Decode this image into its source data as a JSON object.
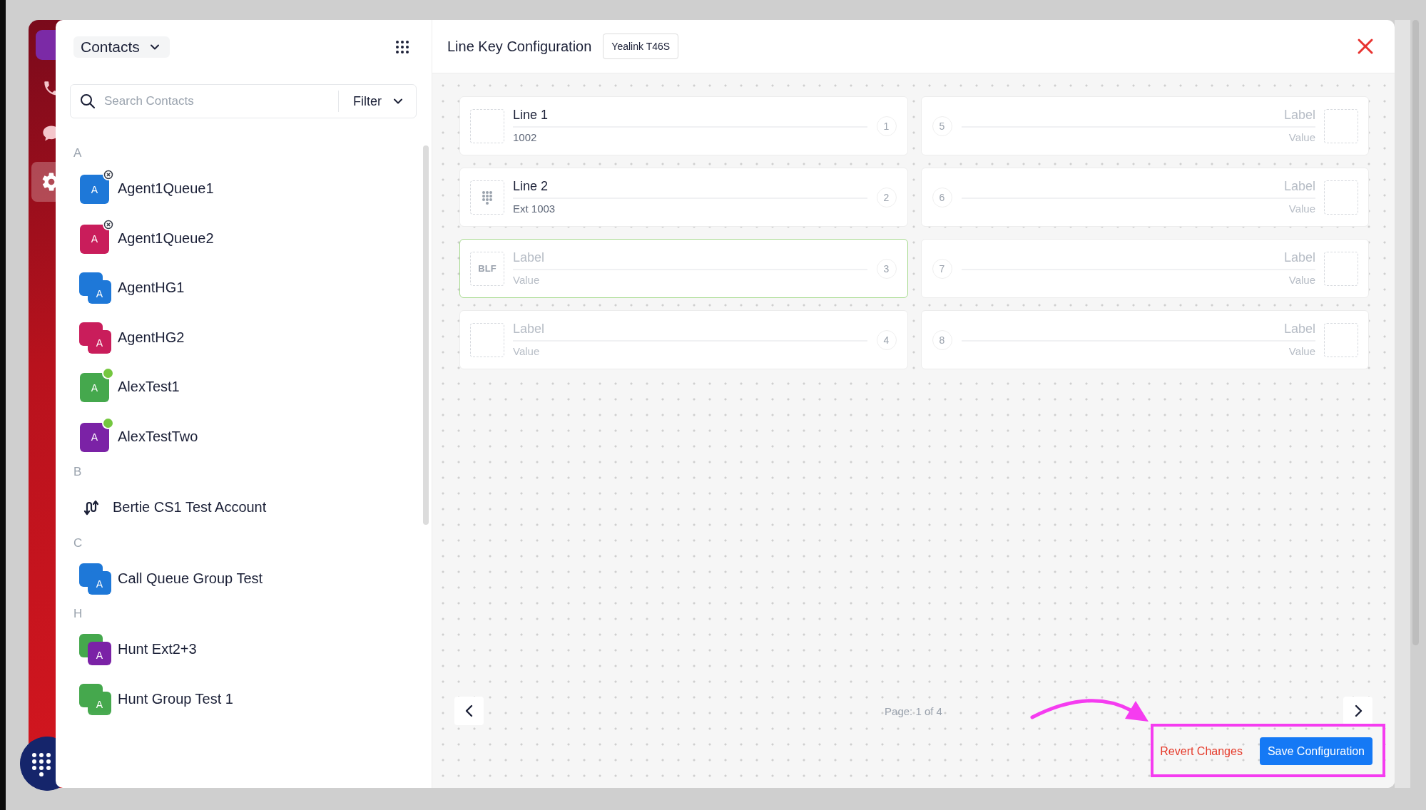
{
  "rail": {
    "items": [
      {
        "kind": "phone",
        "selected": false
      },
      {
        "kind": "chat",
        "selected": false
      },
      {
        "kind": "settings",
        "selected": true
      }
    ]
  },
  "contacts": {
    "title": "Contacts",
    "search": {
      "placeholder": "Search Contacts"
    },
    "filter": "Filter",
    "sections": [
      {
        "letter": "A",
        "items": [
          {
            "name": "Agent1Queue1",
            "kind": "person",
            "initial": "A",
            "color": "#1e78d8",
            "status": {
              "kind": "dnd"
            }
          },
          {
            "name": "Agent1Queue2",
            "kind": "person",
            "initial": "A",
            "color": "#c91d5b",
            "status": {
              "kind": "dnd"
            }
          },
          {
            "name": "AgentHG1",
            "kind": "group",
            "initial": "A",
            "color": "#1e78d8",
            "back": {
              "color": "#1e78d8"
            }
          },
          {
            "name": "AgentHG2",
            "kind": "group",
            "initial": "A",
            "color": "#c91d5b",
            "back": {
              "color": "#c91d5b"
            }
          },
          {
            "name": "AlexTest1",
            "kind": "person",
            "initial": "A",
            "color": "#45a84d",
            "status": {
              "kind": "online"
            }
          },
          {
            "name": "AlexTestTwo",
            "kind": "person",
            "initial": "A",
            "color": "#7b22a6",
            "status": {
              "kind": "online"
            }
          }
        ]
      },
      {
        "letter": "B",
        "items": [
          {
            "name": "Bertie CS1 Test Account",
            "kind": "route"
          }
        ]
      },
      {
        "letter": "C",
        "items": [
          {
            "name": "Call Queue Group Test",
            "kind": "group",
            "initial": "A",
            "color": "#1e78d8",
            "back": {
              "color": "#1e78d8"
            }
          }
        ]
      },
      {
        "letter": "H",
        "items": [
          {
            "name": "Hunt Ext2+3",
            "kind": "group",
            "initial": "A",
            "color": "#7b22a6",
            "back": {
              "color": "#45a84d"
            }
          },
          {
            "name": "Hunt Group Test 1",
            "kind": "group",
            "initial": "A",
            "color": "#45a84d",
            "back": {
              "color": "#45a84d"
            }
          }
        ]
      }
    ]
  },
  "line_keys": {
    "title": "Line Key Configuration",
    "model": "Yealink T46S",
    "columns": [
      {
        "kind": "left",
        "keys": [
          {
            "kind": "blank",
            "number": "1",
            "label_field": {
              "value": "Line 1"
            },
            "value_field": {
              "value": "1002"
            },
            "selected": false
          },
          {
            "kind": "dialpad",
            "number": "2",
            "label_field": {
              "value": "Line 2"
            },
            "value_field": {
              "value": "Ext 1003"
            },
            "selected": false
          },
          {
            "kind": "badge",
            "badge": "BLF",
            "number": "3",
            "label_field": {
              "placeholder": "Label"
            },
            "value_field": {
              "placeholder": "Value"
            },
            "selected": true
          },
          {
            "kind": "blank",
            "number": "4",
            "label_field": {
              "placeholder": "Label"
            },
            "value_field": {
              "placeholder": "Value"
            },
            "selected": false
          }
        ]
      },
      {
        "kind": "right",
        "keys": [
          {
            "kind": "blank",
            "number": "5",
            "label_field": {
              "placeholder": "Label"
            },
            "value_field": {
              "placeholder": "Value"
            },
            "selected": false
          },
          {
            "kind": "blank",
            "number": "6",
            "label_field": {
              "placeholder": "Label"
            },
            "value_field": {
              "placeholder": "Value"
            },
            "selected": false
          },
          {
            "kind": "blank",
            "number": "7",
            "label_field": {
              "placeholder": "Label"
            },
            "value_field": {
              "placeholder": "Value"
            },
            "selected": false
          },
          {
            "kind": "blank",
            "number": "8",
            "label_field": {
              "placeholder": "Label"
            },
            "value_field": {
              "placeholder": "Value"
            },
            "selected": false
          }
        ]
      }
    ],
    "page": "Page: 1 of 4",
    "revert": "Revert Changes",
    "save": "Save Configuration"
  }
}
